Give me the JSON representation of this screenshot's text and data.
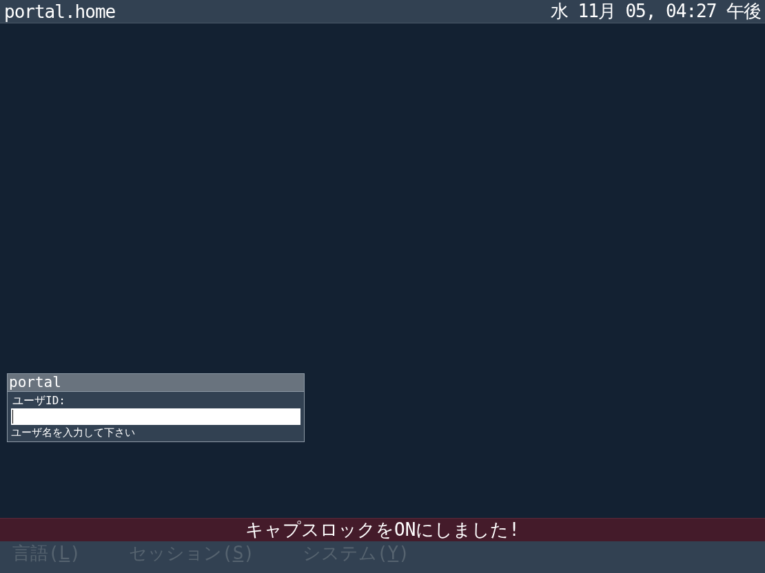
{
  "top_bar": {
    "host": "portal.home",
    "clock": "水 11月 05, 04:27 午後"
  },
  "login_box": {
    "title": "portal",
    "prompt": "ユーザID:",
    "input": {
      "focused": true
    },
    "hint": "ユーザ名を入力して下さい"
  },
  "message_bar": {
    "text": "キャプスロックをONにしました!"
  },
  "menu_bar": {
    "items": [
      {
        "before": "言語(",
        "mnemonic": "L",
        "after": ")",
        "disabled": true
      },
      {
        "before": "セッション(",
        "mnemonic": "S",
        "after": ")",
        "disabled": true
      },
      {
        "before": "システム(",
        "mnemonic": "Y",
        "after": ")",
        "disabled": true
      }
    ]
  }
}
